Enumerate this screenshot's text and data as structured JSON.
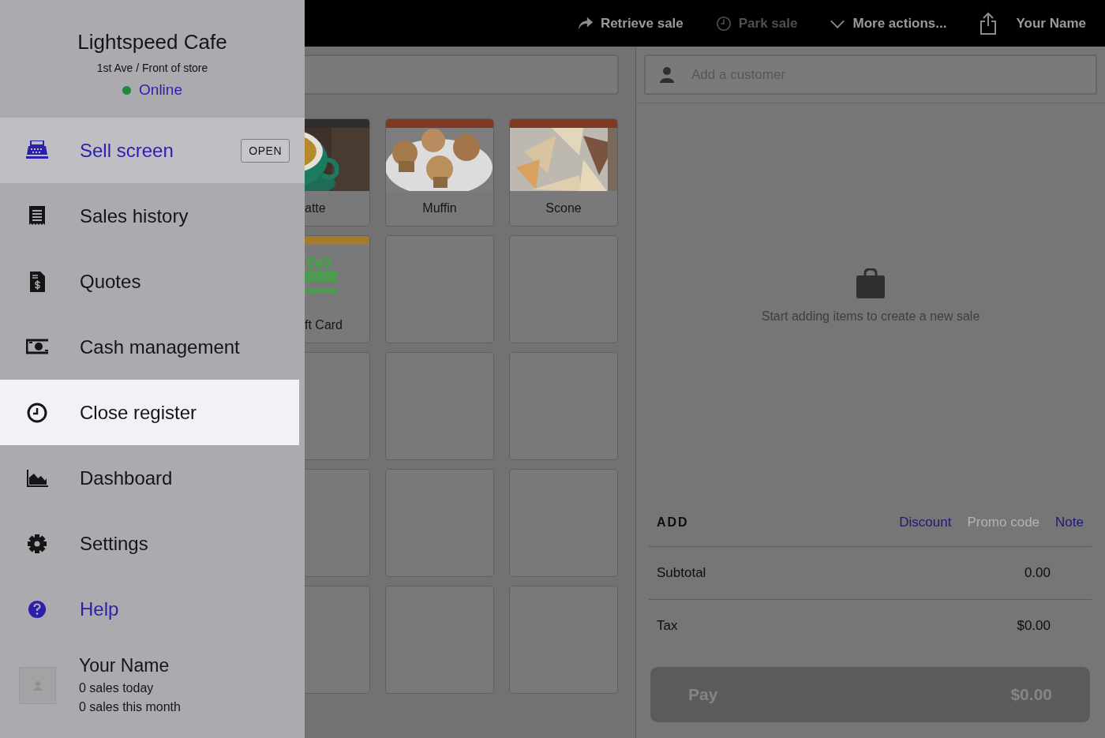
{
  "top_bar": {
    "actions": [
      {
        "label": "Retrieve sale",
        "disabled": false
      },
      {
        "label": "Park sale",
        "disabled": true
      },
      {
        "label": "More actions...",
        "disabled": false
      }
    ],
    "user_name": "Your Name"
  },
  "products": [
    {
      "name": "atte",
      "color": "#2e2e30"
    },
    {
      "name": "Muffin",
      "color": "#7e3a22"
    },
    {
      "name": "Scone",
      "color": "#7e3a22"
    },
    {
      "name": "ft Card",
      "kind": "gift",
      "color": "#a37b2a"
    },
    {
      "kind": "empty"
    },
    {
      "kind": "empty"
    },
    {
      "kind": "empty"
    },
    {
      "kind": "empty"
    },
    {
      "kind": "empty"
    },
    {
      "kind": "empty"
    },
    {
      "kind": "empty"
    },
    {
      "kind": "empty"
    },
    {
      "kind": "empty"
    },
    {
      "kind": "empty"
    },
    {
      "kind": "empty"
    }
  ],
  "cart": {
    "customer": {
      "placeholder": "Add a customer"
    },
    "empty_message": "Start adding items to create a new sale",
    "add": {
      "label": "ADD",
      "links": [
        {
          "label": "Discount",
          "disabled": false
        },
        {
          "label": "Promo code",
          "disabled": true
        },
        {
          "label": "Note",
          "disabled": false
        }
      ]
    },
    "totals": [
      {
        "label": "Subtotal",
        "value": "0.00"
      },
      {
        "label": "Tax",
        "value": "$0.00"
      }
    ],
    "pay": {
      "label": "Pay",
      "amount": "$0.00",
      "disabled": true
    }
  },
  "drawer": {
    "store": {
      "name": "Lightspeed Cafe",
      "location": "1st Ave / Front of store",
      "status": {
        "label": "Online",
        "online": true
      }
    },
    "menu": [
      {
        "label": "Sell screen",
        "kind": "nav",
        "selected": true,
        "highlighted": false,
        "badge": "OPEN"
      },
      {
        "label": "Sales history",
        "kind": "nav",
        "selected": false,
        "highlighted": false
      },
      {
        "label": "Quotes",
        "kind": "nav",
        "selected": false,
        "highlighted": false
      },
      {
        "label": "Cash management",
        "kind": "nav",
        "selected": false,
        "highlighted": false
      },
      {
        "label": "Close register",
        "kind": "nav",
        "selected": false,
        "highlighted": true
      },
      {
        "label": "Dashboard",
        "kind": "nav",
        "selected": false,
        "highlighted": false
      },
      {
        "label": "Settings",
        "kind": "nav",
        "selected": false,
        "highlighted": false
      },
      {
        "label": "Help",
        "kind": "link",
        "selected": false,
        "highlighted": false
      }
    ],
    "user": {
      "name": "Your Name",
      "lines": [
        "0 sales today",
        "0 sales this month"
      ]
    }
  }
}
